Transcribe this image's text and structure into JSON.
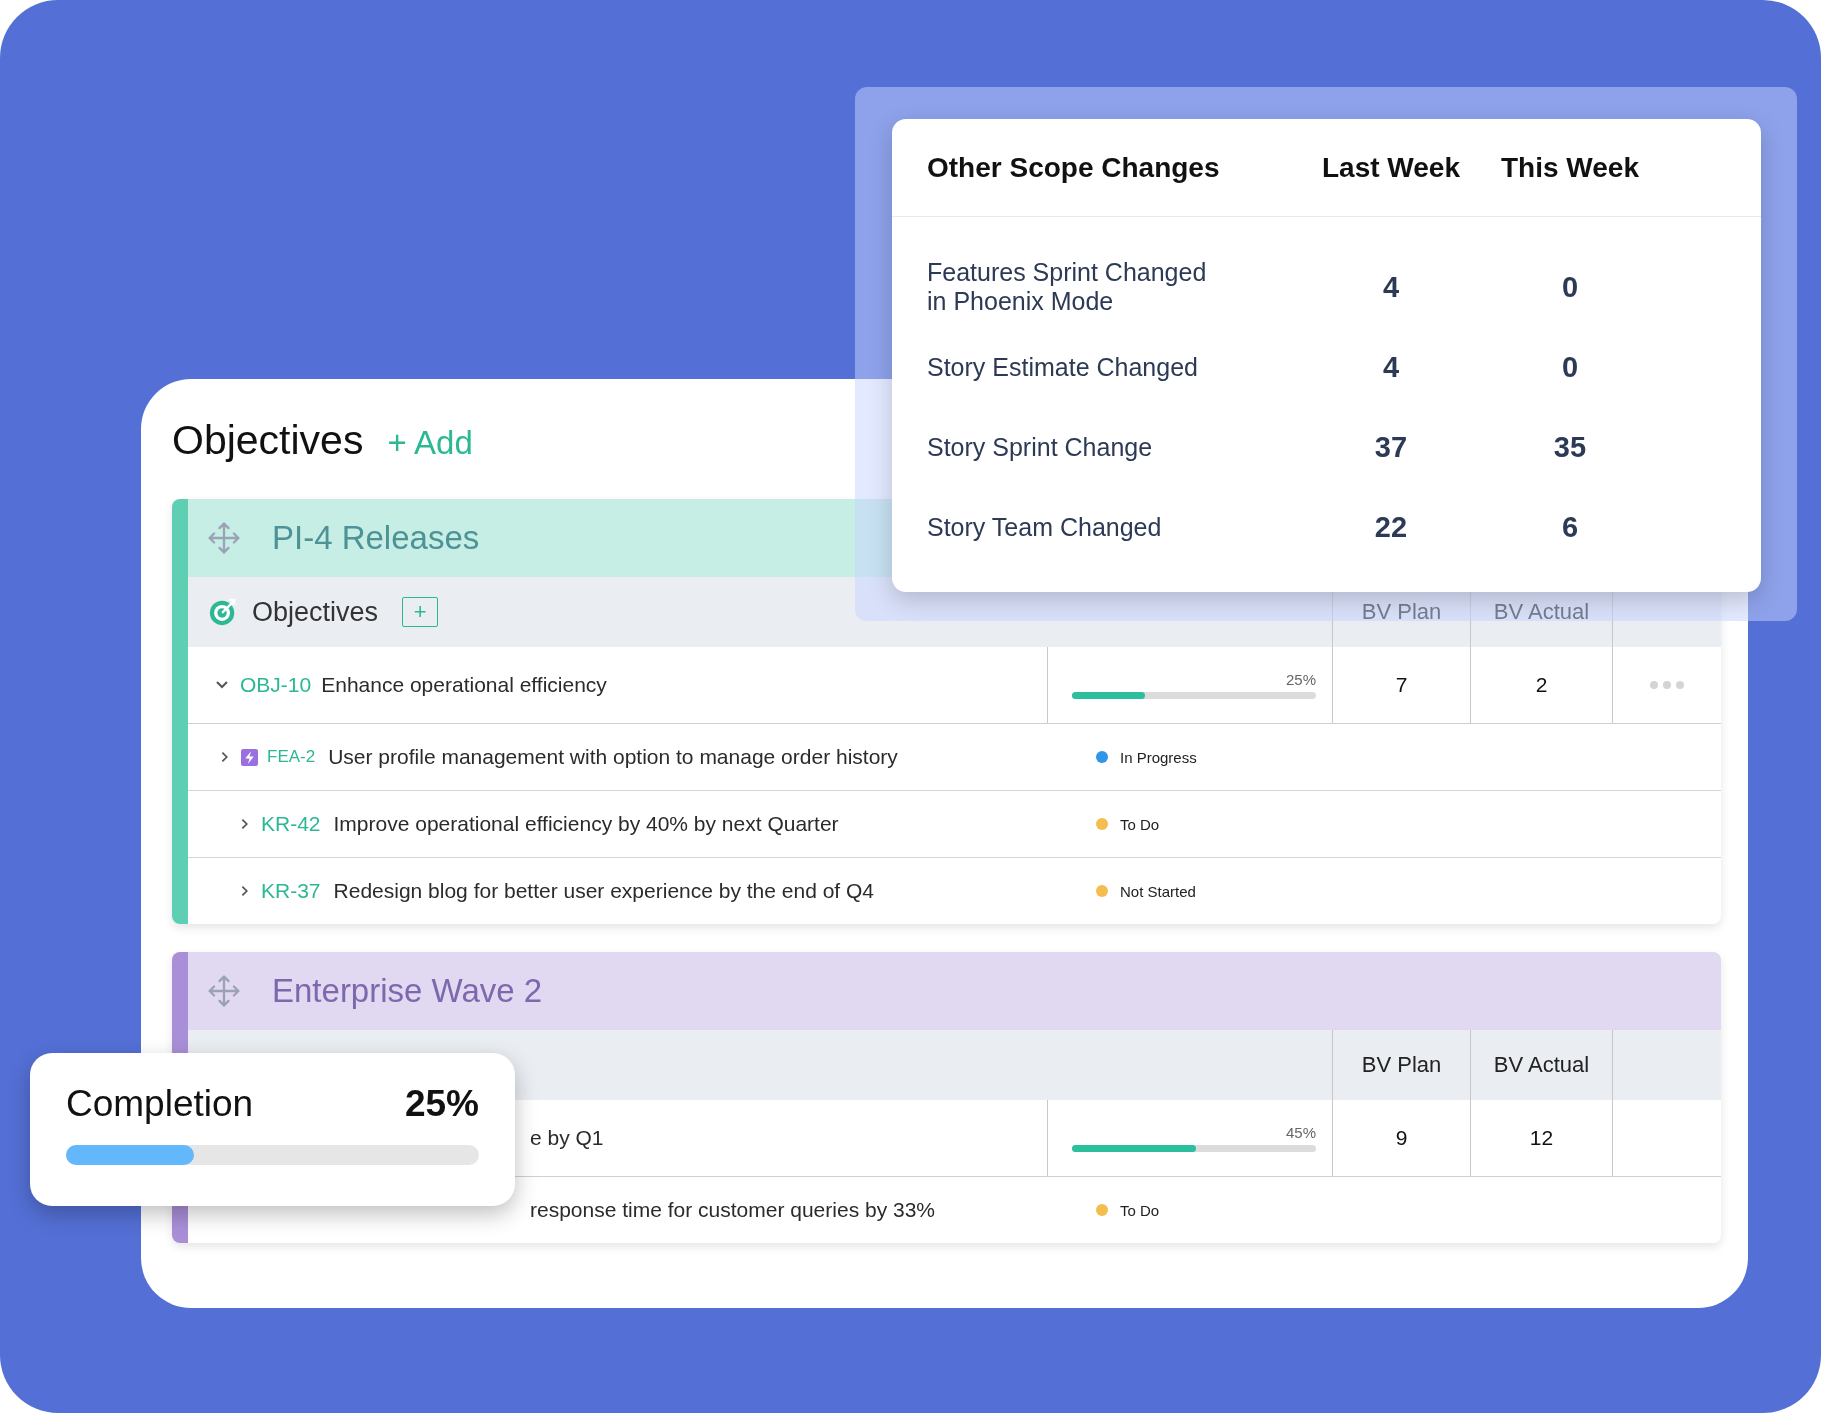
{
  "main": {
    "title": "Objectives",
    "add_label": "+ Add"
  },
  "sections": [
    {
      "title": "PI-4 Releases",
      "color": "#5ecfb3",
      "subheader": {
        "label": "Objectives",
        "add_label": "+",
        "columns": [
          "BV Plan",
          "BV Actual"
        ]
      },
      "objective": {
        "id": "OBJ-10",
        "title": "Enhance operational efficiency",
        "expanded": true,
        "progress": {
          "level": 0.3,
          "label": "25%"
        },
        "bv_plan": "7",
        "bv_actual": "2",
        "menu": true
      },
      "children": [
        {
          "kind": "feature",
          "id": "FEA-2",
          "title": "User profile management with option to manage order history",
          "expanded": false,
          "status": {
            "label": "In Progress",
            "color": "#2f96ea"
          }
        },
        {
          "kind": "key_result",
          "id": "KR-42",
          "title": "Improve operational efficiency by 40% by next Quarter",
          "expanded": false,
          "status": {
            "label": "To Do",
            "color": "#f5bd4f"
          }
        },
        {
          "kind": "key_result",
          "id": "KR-37",
          "title": "Redesign blog for better user experience by the end of Q4",
          "expanded": false,
          "status": {
            "label": "Not Started",
            "color": "#f5bd4f"
          }
        }
      ]
    },
    {
      "title": "Enterprise Wave 2",
      "color": "#a98fd8",
      "subheader": {
        "columns": [
          "BV Plan",
          "BV Actual"
        ]
      },
      "objective": {
        "title": "e by Q1",
        "progress": {
          "level": 0.51,
          "label": "45%"
        },
        "bv_plan": "9",
        "bv_actual": "12",
        "menu": false
      },
      "children": [
        {
          "kind": "key_result",
          "title": "response time for customer queries by 33%",
          "status": {
            "label": "To Do",
            "color": "#f5bd4f"
          }
        }
      ]
    }
  ],
  "scope_changes": {
    "columns": [
      "Other Scope Changes",
      "Last Week",
      "This Week"
    ],
    "rows": [
      {
        "label": "Features Sprint Changed in Phoenix Mode",
        "last_week": "4",
        "this_week": "0"
      },
      {
        "label": "Story Estimate Changed",
        "last_week": "4",
        "this_week": "0"
      },
      {
        "label": "Story Sprint Change",
        "last_week": "37",
        "this_week": "35"
      },
      {
        "label": "Story Team Changed",
        "last_week": "22",
        "this_week": "6"
      }
    ]
  },
  "completion": {
    "label": "Completion",
    "value": "25%",
    "level": 0.31
  }
}
